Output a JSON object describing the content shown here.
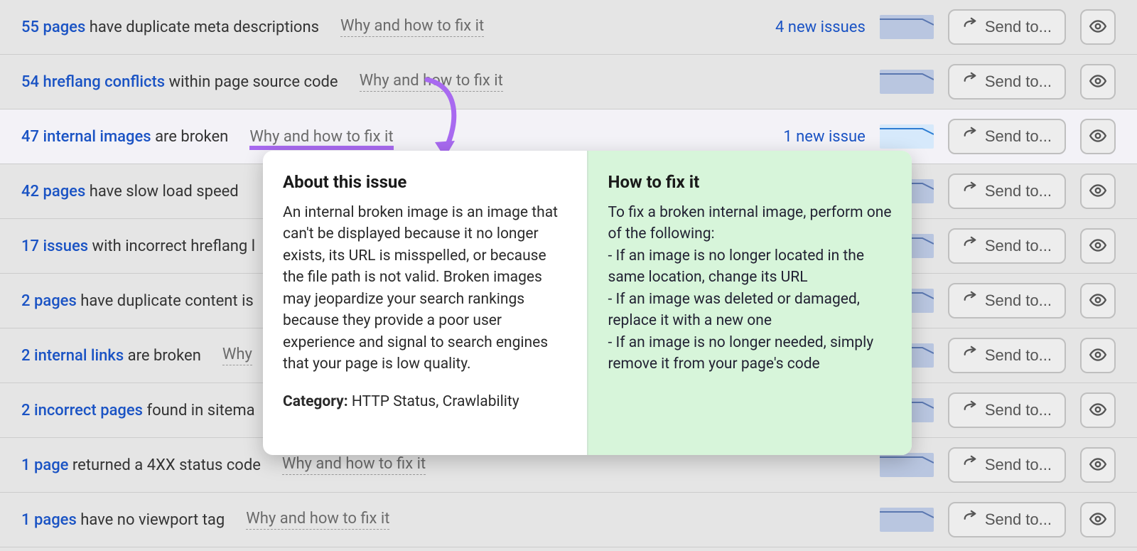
{
  "common": {
    "fix_link_label": "Why and how to fix it",
    "send_to_label": "Send to..."
  },
  "rows": [
    {
      "link_text": "55 pages",
      "rest_text": " have duplicate meta descriptions",
      "new_issues": "4 new issues",
      "highlight": false,
      "spark_light": false
    },
    {
      "link_text": "54 hreflang conflicts",
      "rest_text": " within page source code",
      "new_issues": "",
      "highlight": false,
      "spark_light": false
    },
    {
      "link_text": "47 internal images",
      "rest_text": " are broken",
      "new_issues": "1 new issue",
      "highlight": true,
      "spark_light": true
    },
    {
      "link_text": "42 pages",
      "rest_text": " have slow load speed",
      "new_issues": "",
      "highlight": false,
      "spark_light": false
    },
    {
      "link_text": "17 issues",
      "rest_text": " with incorrect hreflang l",
      "new_issues": "",
      "highlight": false,
      "spark_light": false
    },
    {
      "link_text": "2 pages",
      "rest_text": " have duplicate content is",
      "new_issues": "",
      "highlight": false,
      "spark_light": false
    },
    {
      "link_text": "2 internal links",
      "rest_text": " are broken",
      "new_issues": "",
      "highlight": false,
      "spark_light": false
    },
    {
      "link_text": "2 incorrect pages",
      "rest_text": " found in sitema",
      "new_issues": "",
      "highlight": false,
      "spark_light": false
    },
    {
      "link_text": "1 page",
      "rest_text": " returned a 4XX status code",
      "new_issues": "",
      "highlight": false,
      "spark_light": false
    },
    {
      "link_text": "1 pages",
      "rest_text": " have no viewport tag",
      "new_issues": "",
      "highlight": false,
      "spark_light": false
    }
  ],
  "popup": {
    "about_title": "About this issue",
    "about_body": "An internal broken image is an image that can't be displayed because it no longer exists, its URL is misspelled, or because the file path is not valid. Broken images may jeopardize your search rankings because they provide a poor user experience and signal to search engines that your page is low quality.",
    "category_label": "Category:",
    "category_value": " HTTP Status, Crawlability",
    "fix_title": "How to fix it",
    "fix_body": "To fix a broken internal image, perform one of the following:\n- If an image is no longer located in the same location, change its URL\n- If an image was deleted or damaged, replace it with a new one\n- If an image is no longer needed, simply remove it from your page's code"
  }
}
